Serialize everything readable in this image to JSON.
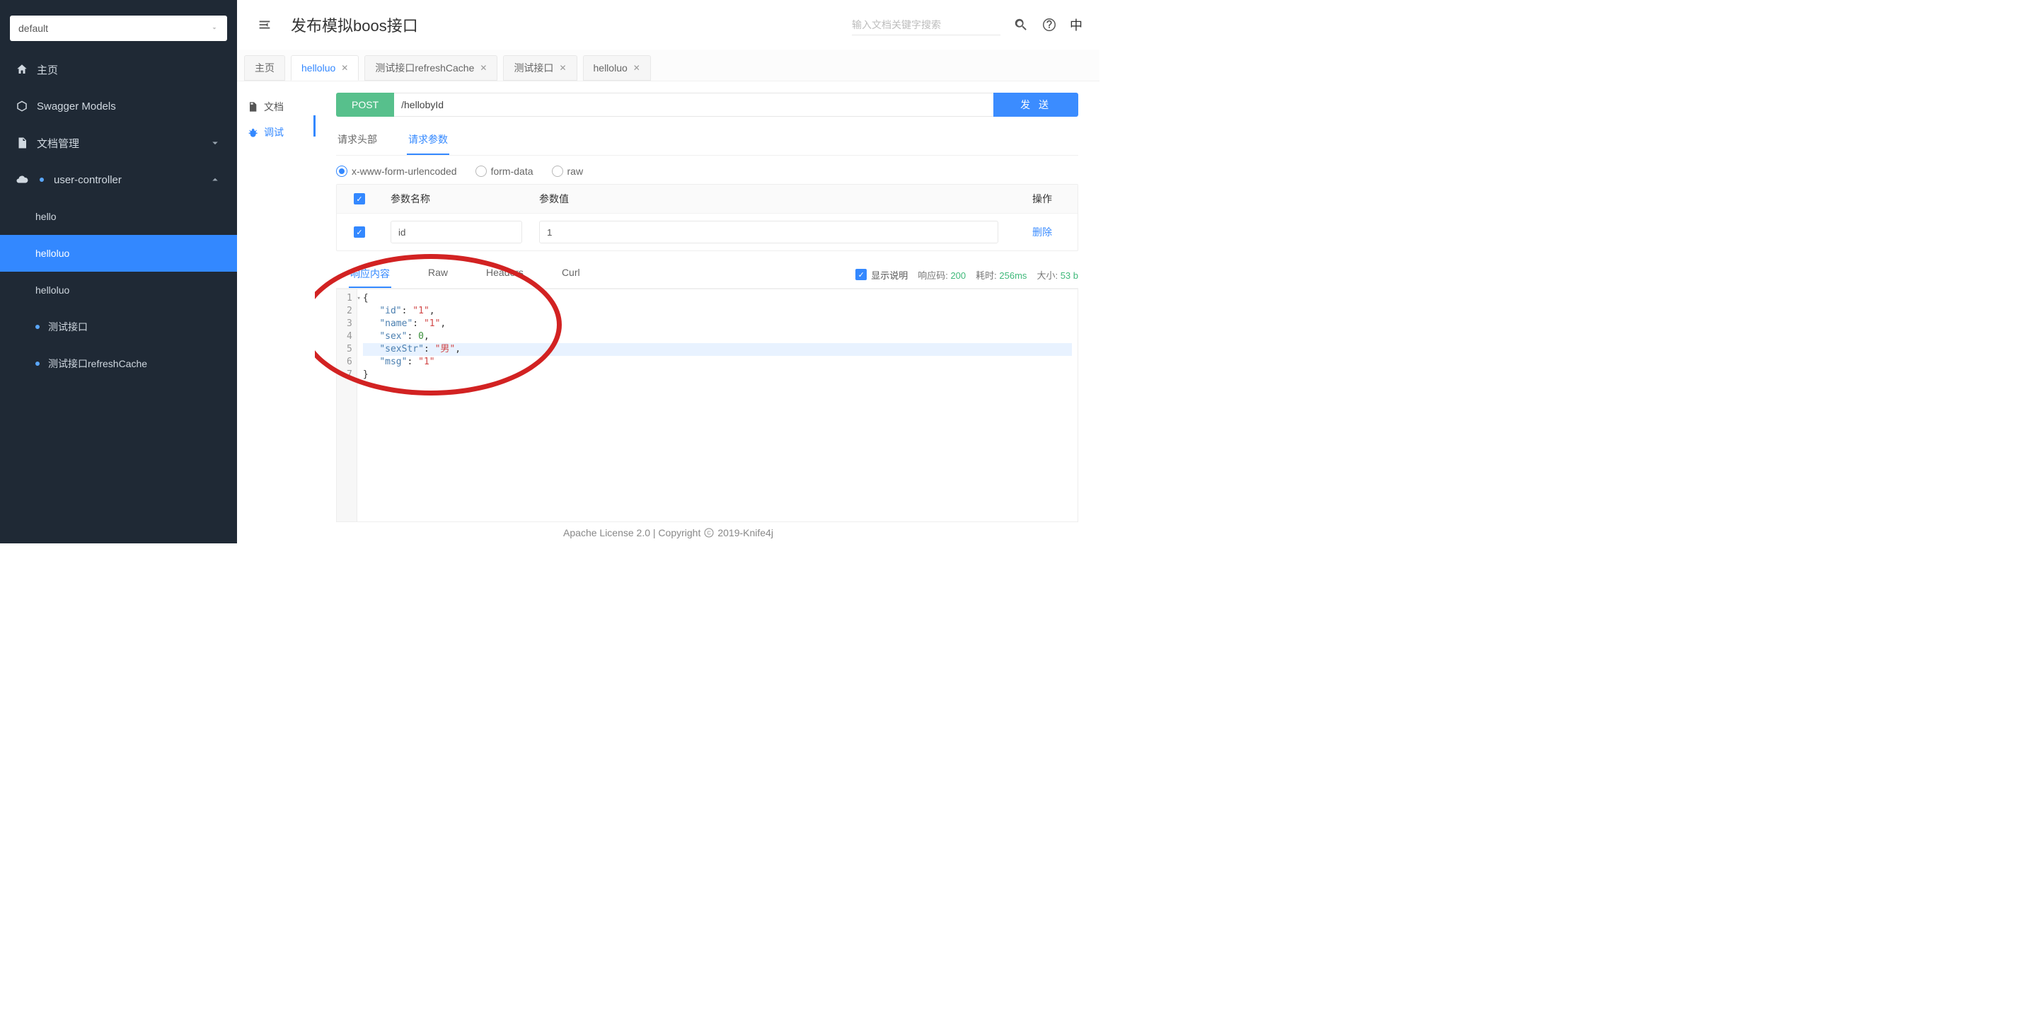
{
  "sidebar": {
    "selector_value": "default",
    "items": [
      {
        "label": "主页"
      },
      {
        "label": "Swagger Models"
      },
      {
        "label": "文档管理"
      },
      {
        "label": "user-controller"
      }
    ],
    "sub": [
      {
        "label": "hello"
      },
      {
        "label": "helloluo"
      },
      {
        "label": "helloluo"
      },
      {
        "label": "测试接口"
      },
      {
        "label": "测试接口refreshCache"
      }
    ]
  },
  "header": {
    "title": "发布模拟boos接口",
    "search_placeholder": "输入文档关键字搜索",
    "lang": "中"
  },
  "tabs": [
    {
      "label": "主页"
    },
    {
      "label": "helloluo"
    },
    {
      "label": "测试接口refreshCache"
    },
    {
      "label": "测试接口"
    },
    {
      "label": "helloluo"
    }
  ],
  "subnav": [
    {
      "label": "文档"
    },
    {
      "label": "调试"
    }
  ],
  "api": {
    "method": "POST",
    "url": "/hellobyId",
    "send_label": "发 送",
    "req_tabs": [
      {
        "label": "请求头部"
      },
      {
        "label": "请求参数"
      }
    ],
    "body_types": [
      {
        "label": "x-www-form-urlencoded"
      },
      {
        "label": "form-data"
      },
      {
        "label": "raw"
      }
    ],
    "params_header": {
      "name": "参数名称",
      "value": "参数值",
      "action": "操作"
    },
    "params": [
      {
        "name": "id",
        "value": "1",
        "delete": "删除"
      }
    ]
  },
  "response": {
    "tabs": [
      {
        "label": "响应内容"
      },
      {
        "label": "Raw"
      },
      {
        "label": "Headers"
      },
      {
        "label": "Curl"
      }
    ],
    "show_desc": "显示说明",
    "code_label": "响应码:",
    "code": "200",
    "time_label": "耗时:",
    "time": "256ms",
    "size_label": "大小:",
    "size": "53 b",
    "json": {
      "id": "1",
      "name": "1",
      "sex": 0,
      "sexStr": "男",
      "msg": "1"
    }
  },
  "footer": {
    "text_left": "Apache License 2.0 | Copyright ",
    "text_right": " 2019-Knife4j"
  }
}
